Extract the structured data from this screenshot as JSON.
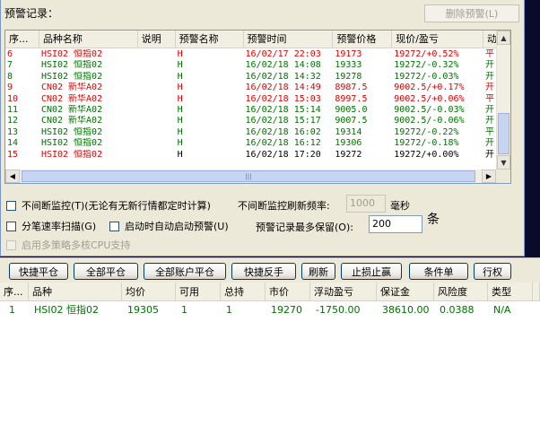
{
  "alert": {
    "header": "预警记录：",
    "delete_label": "删除预警(L)",
    "columns": [
      "序...",
      "品种名称",
      "说明",
      "预警名称",
      "预警时间",
      "预警价格",
      "现价/盈亏",
      "动"
    ],
    "rows": [
      {
        "no": "6",
        "name": "HSI02 恒指02",
        "desc": "",
        "alert": "H",
        "time": "16/02/17 22:03",
        "price": "19173",
        "current": "19272/+0.52%",
        "act": "平",
        "color": "red"
      },
      {
        "no": "7",
        "name": "HSI02 恒指02",
        "desc": "",
        "alert": "H",
        "time": "16/02/18 14:08",
        "price": "19333",
        "current": "19272/-0.32%",
        "act": "开",
        "color": "green"
      },
      {
        "no": "8",
        "name": "HSI02 恒指02",
        "desc": "",
        "alert": "H",
        "time": "16/02/18 14:32",
        "price": "19278",
        "current": "19272/-0.03%",
        "act": "开",
        "color": "green"
      },
      {
        "no": "9",
        "name": "CN02 新华A02",
        "desc": "",
        "alert": "H",
        "time": "16/02/18 14:49",
        "price": "8987.5",
        "current": "9002.5/+0.17%",
        "act": "开",
        "color": "red"
      },
      {
        "no": "10",
        "name": "CN02 新华A02",
        "desc": "",
        "alert": "H",
        "time": "16/02/18 15:03",
        "price": "8997.5",
        "current": "9002.5/+0.06%",
        "act": "平",
        "color": "red"
      },
      {
        "no": "11",
        "name": "CN02 新华A02",
        "desc": "",
        "alert": "H",
        "time": "16/02/18 15:14",
        "price": "9005.0",
        "current": "9002.5/-0.03%",
        "act": "开",
        "color": "green"
      },
      {
        "no": "12",
        "name": "CN02 新华A02",
        "desc": "",
        "alert": "H",
        "time": "16/02/18 15:17",
        "price": "9007.5",
        "current": "9002.5/-0.06%",
        "act": "开",
        "color": "green"
      },
      {
        "no": "13",
        "name": "HSI02 恒指02",
        "desc": "",
        "alert": "H",
        "time": "16/02/18 16:02",
        "price": "19314",
        "current": "19272/-0.22%",
        "act": "平",
        "color": "green"
      },
      {
        "no": "14",
        "name": "HSI02 恒指02",
        "desc": "",
        "alert": "H",
        "time": "16/02/18 16:12",
        "price": "19306",
        "current": "19272/-0.18%",
        "act": "开",
        "color": "green"
      },
      {
        "no": "15",
        "name": "HSI02 恒指02",
        "desc": "",
        "alert": "H",
        "time": "16/02/18 17:20",
        "price": "19272",
        "current": "19272/+0.00%",
        "act": "开",
        "color": "mixed"
      }
    ]
  },
  "options": {
    "continuous_monitor": "不间断监控(T)(无论有无新行情都定时计算)",
    "refresh_label": "不间断监控刷新频率:",
    "refresh_value": "1000",
    "refresh_unit": "毫秒",
    "tick_scan": "分笔速率扫描(G)",
    "auto_start": "启动时自动启动预警(U)",
    "max_keep_label": "预警记录最多保留(O):",
    "max_keep_value": "200",
    "max_keep_unit": "条",
    "multi_cpu": "启用多策略多核CPU支持"
  },
  "toolbar": [
    "快捷平仓",
    "全部平仓",
    "全部账户平仓",
    "快捷反手",
    "刷新",
    "止损止赢",
    "条件单",
    "行权"
  ],
  "positions": {
    "columns": [
      "序...",
      "品种",
      "均价",
      "可用",
      "总持",
      "市价",
      "浮动盈亏",
      "保证金",
      "风险度",
      "类型"
    ],
    "rows": [
      {
        "no": "1",
        "name": "HSI02 恒指02",
        "avg": "19305",
        "avail": "1",
        "total": "1",
        "market": "19270",
        "pnl": "-1750.00",
        "margin": "38610.00",
        "risk": "0.0388",
        "type": "N/A"
      }
    ]
  },
  "colors": {
    "red": "#e00000",
    "green": "#007000"
  }
}
